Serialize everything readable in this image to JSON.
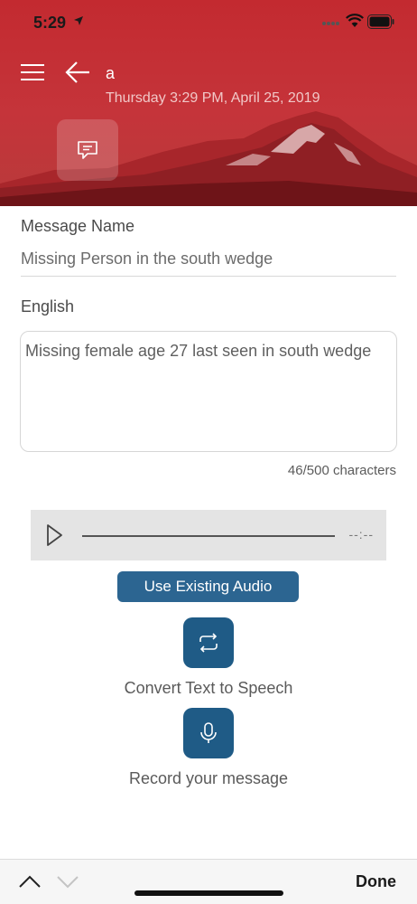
{
  "status_bar": {
    "time": "5:29",
    "icons": [
      "location-arrow-icon",
      "signal-icon",
      "wifi-icon",
      "battery-icon"
    ]
  },
  "header": {
    "title": "a",
    "subtitle": "Thursday 3:29 PM, April 25, 2019",
    "icons": [
      "menu-icon",
      "back-arrow-icon",
      "message-icon"
    ]
  },
  "form": {
    "name_label": "Message Name",
    "name_value": "Missing Person in the south wedge",
    "language_label": "English",
    "message_text": "Missing female age 27 last seen in south wedge",
    "char_count": "46/500 characters"
  },
  "player": {
    "duration": "--:--",
    "progress": 0
  },
  "actions": {
    "use_existing_audio": "Use Existing Audio",
    "convert_label": "Convert Text to Speech",
    "record_label": "Record your message"
  },
  "bottom_bar": {
    "done": "Done"
  },
  "colors": {
    "header_red": "#c32a30",
    "button_blue": "#2c6591",
    "icon_button_blue": "#1f5b86"
  }
}
